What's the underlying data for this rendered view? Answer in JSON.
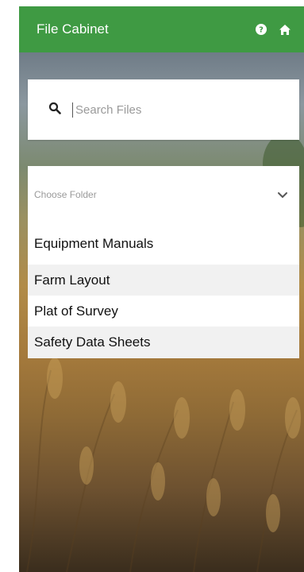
{
  "header": {
    "title": "File Cabinet",
    "icons": [
      "help-icon",
      "home-icon"
    ],
    "color": "#3f9a43"
  },
  "search": {
    "placeholder": "Search Files",
    "value": "",
    "icon": "search-icon"
  },
  "folder_select": {
    "label": "Choose Folder",
    "icon": "chevron-down-icon"
  },
  "folders": [
    {
      "label": "Equipment Manuals"
    },
    {
      "label": "Farm Layout"
    },
    {
      "label": "Plat of Survey"
    },
    {
      "label": "Safety Data Sheets"
    }
  ]
}
